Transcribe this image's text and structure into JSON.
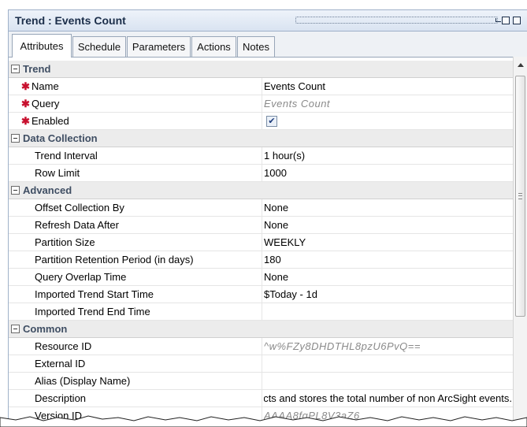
{
  "window": {
    "title": "Trend : Events Count"
  },
  "tabs": [
    {
      "label": "Attributes",
      "active": true
    },
    {
      "label": "Schedule",
      "active": false
    },
    {
      "label": "Parameters",
      "active": false
    },
    {
      "label": "Actions",
      "active": false
    },
    {
      "label": "Notes",
      "active": false
    }
  ],
  "sections": {
    "trend": {
      "label": "Trend",
      "name": {
        "label": "Name",
        "value": "Events Count",
        "required": true
      },
      "query": {
        "label": "Query",
        "value": "Events Count",
        "required": true
      },
      "enabled": {
        "label": "Enabled",
        "checked": true,
        "required": true
      }
    },
    "data_collection": {
      "label": "Data Collection",
      "trend_interval": {
        "label": "Trend Interval",
        "value": "1 hour(s)"
      },
      "row_limit": {
        "label": "Row Limit",
        "value": "1000"
      }
    },
    "advanced": {
      "label": "Advanced",
      "offset_collection_by": {
        "label": "Offset Collection By",
        "value": "None"
      },
      "refresh_data_after": {
        "label": "Refresh Data After",
        "value": "None"
      },
      "partition_size": {
        "label": "Partition Size",
        "value": "WEEKLY"
      },
      "partition_retention": {
        "label": "Partition Retention Period (in days)",
        "value": "180"
      },
      "query_overlap_time": {
        "label": "Query Overlap Time",
        "value": "None"
      },
      "imported_start": {
        "label": "Imported Trend Start Time",
        "value": "$Today - 1d"
      },
      "imported_end": {
        "label": "Imported Trend End Time",
        "value": ""
      }
    },
    "common": {
      "label": "Common",
      "resource_id": {
        "label": "Resource ID",
        "value": "^w%FZy8DHDTHL8pzU6PvQ=="
      },
      "external_id": {
        "label": "External ID",
        "value": ""
      },
      "alias": {
        "label": "Alias (Display Name)",
        "value": ""
      },
      "description": {
        "label": "Description",
        "value": "Trend that collects and stores the total number of non ArcSight events."
      },
      "version_id": {
        "label": "Version ID",
        "value": "AAAA8fqPL8V3aZ6"
      }
    }
  },
  "icons": {
    "collapse": "collapse-toggle-icon",
    "required": "required-asterisk-icon",
    "scroll_up": "scroll-up-arrow-icon"
  },
  "colors": {
    "required": "#c8102e",
    "category_bg": "#ececec",
    "title_bg": "#d9e3f1"
  }
}
